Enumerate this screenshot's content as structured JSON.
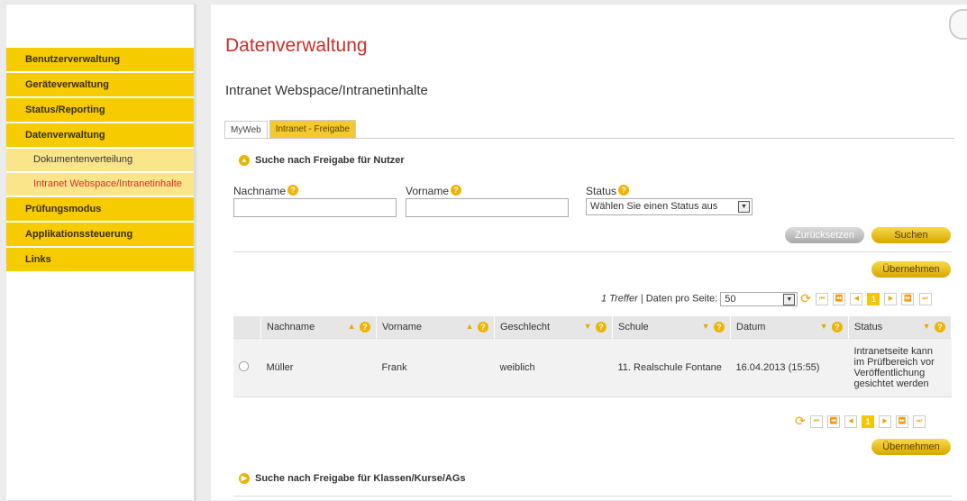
{
  "sidebar": {
    "items": [
      {
        "label": "Benutzerverwaltung"
      },
      {
        "label": "Geräteverwaltung"
      },
      {
        "label": "Status/Reporting"
      },
      {
        "label": "Datenverwaltung"
      }
    ],
    "subitems": [
      {
        "label": "Dokumentenverteilung"
      },
      {
        "label": "Intranet Webspace/Intranetinhalte"
      }
    ],
    "items_after": [
      {
        "label": "Prüfungsmodus"
      },
      {
        "label": "Applikationssteuerung"
      },
      {
        "label": "Links"
      }
    ]
  },
  "page": {
    "title": "Datenverwaltung",
    "subtitle": "Intranet Webspace/Intranetinhalte"
  },
  "tabs": [
    {
      "label": "MyWeb"
    },
    {
      "label": "Intranet - Freigabe"
    }
  ],
  "search_user": {
    "heading": "Suche nach Freigabe für Nutzer",
    "nachname_label": "Nachname",
    "vorname_label": "Vorname",
    "status_label": "Status",
    "status_placeholder": "Wählen Sie einen Status aus",
    "reset_label": "Zurücksetzen",
    "search_label": "Suchen"
  },
  "results": {
    "apply_label": "Übernehmen",
    "hits": "1 Treffer",
    "per_page_label": "| Daten pro Seite:",
    "per_page_value": "50",
    "current_page": "1",
    "columns": [
      "Nachname",
      "Vorname",
      "Geschlecht",
      "Schule",
      "Datum",
      "Status"
    ],
    "rows": [
      {
        "nachname": "Müller",
        "vorname": "Frank",
        "geschlecht": "weiblich",
        "schule": "11. Realschule Fontane",
        "datum": "16.04.2013 (15:55)",
        "status": "Intranetseite kann im Prüfbereich vor Veröffentlichung gesichtet werden"
      }
    ]
  },
  "search_class": {
    "heading": "Suche nach Freigabe für Klassen/Kurse/AGs"
  },
  "colors": {
    "accent_yellow": "#f6cb00",
    "title_red": "#c9302c"
  }
}
